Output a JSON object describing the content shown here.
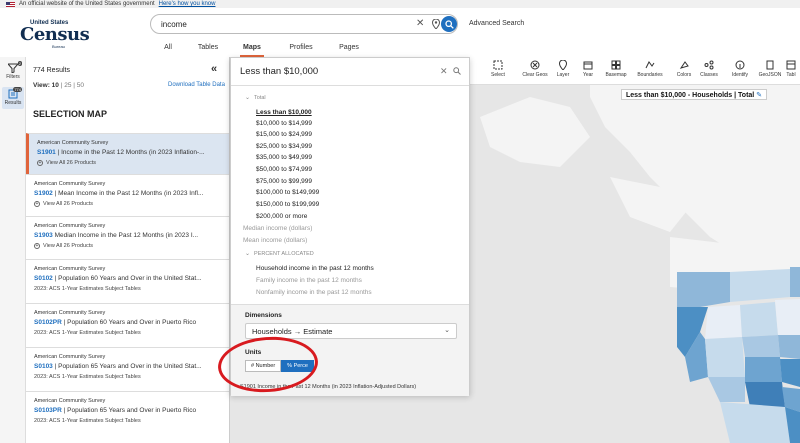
{
  "gov_banner": {
    "text": "An official website of the United States government",
    "link": "Here's how you know"
  },
  "logo": {
    "top": "United States",
    "main": "Census",
    "bureau": "Bureau"
  },
  "search": {
    "value": "income",
    "advanced": "Advanced Search"
  },
  "tabs": [
    {
      "label": "All",
      "active": false
    },
    {
      "label": "Tables",
      "active": false
    },
    {
      "label": "Maps",
      "active": true
    },
    {
      "label": "Profiles",
      "active": false
    },
    {
      "label": "Pages",
      "active": false
    }
  ],
  "rail": {
    "filters": {
      "label": "Filters",
      "badge": "2"
    },
    "results": {
      "label": "Results",
      "badge": "774"
    }
  },
  "results": {
    "count": "774 Results",
    "view_label": "View:",
    "view_options": [
      "10",
      "25",
      "50"
    ],
    "download": "Download Table Data",
    "heading": "SELECTION MAP",
    "cards": [
      {
        "source": "American Community Survey",
        "code": "S1901",
        "title": "Income in the Past 12 Months (in 2023 Inflation-...",
        "sub": "View All 26 Products",
        "plus": true,
        "active": true
      },
      {
        "source": "American Community Survey",
        "code": "S1902",
        "title": "Mean Income in the Past 12 Months (in 2023 Infl...",
        "sub": "View All 26 Products",
        "plus": true,
        "active": false
      },
      {
        "source": "American Community Survey",
        "code": "S1903",
        "title": "Median Income in the Past 12 Months (in 2023 I...",
        "sub": "View All 26 Products",
        "plus": true,
        "active": false
      },
      {
        "source": "American Community Survey",
        "code": "S0102",
        "title": "Population 60 Years and Over in the United Stat...",
        "sub": "2023: ACS 1-Year Estimates Subject Tables",
        "plus": false,
        "active": false
      },
      {
        "source": "American Community Survey",
        "code": "S0102PR",
        "title": "Population 60 Years and Over in Puerto Rico",
        "sub": "2023: ACS 1-Year Estimates Subject Tables",
        "plus": false,
        "active": false
      },
      {
        "source": "American Community Survey",
        "code": "S0103",
        "title": "Population 65 Years and Over in the United Stat...",
        "sub": "2023: ACS 1-Year Estimates Subject Tables",
        "plus": false,
        "active": false
      },
      {
        "source": "American Community Survey",
        "code": "S0103PR",
        "title": "Population 65 Years and Over in Puerto Rico",
        "sub": "2023: ACS 1-Year Estimates Subject Tables",
        "plus": false,
        "active": false
      }
    ]
  },
  "toolbar": [
    {
      "label": "Select",
      "icon": "select-icon"
    },
    {
      "label": "Clear Geos",
      "icon": "clear-icon"
    },
    {
      "label": "Layer",
      "icon": "layer-pin-icon"
    },
    {
      "label": "Year",
      "icon": "calendar-icon"
    },
    {
      "label": "Basemap",
      "icon": "basemap-icon"
    },
    {
      "label": "Boundaries",
      "icon": "boundaries-icon"
    },
    {
      "label": "Colors",
      "icon": "colors-icon"
    },
    {
      "label": "Classes",
      "icon": "classes-icon"
    },
    {
      "label": "Identify",
      "icon": "identify-icon"
    },
    {
      "label": "GeoJSON",
      "icon": "geojson-icon"
    },
    {
      "label": "Tabl",
      "icon": "table-icon"
    }
  ],
  "map": {
    "title": "Less than $10,000 - Households | Total"
  },
  "dropdown": {
    "value": "Less than $10,000",
    "rows": [
      {
        "text": "Total",
        "kind": "header"
      },
      {
        "text": "Less than $10,000",
        "kind": "selected"
      },
      {
        "text": "$10,000 to $14,999",
        "kind": "item"
      },
      {
        "text": "$15,000 to $24,999",
        "kind": "item"
      },
      {
        "text": "$25,000 to $34,999",
        "kind": "item"
      },
      {
        "text": "$35,000 to $49,999",
        "kind": "item"
      },
      {
        "text": "$50,000 to $74,999",
        "kind": "item"
      },
      {
        "text": "$75,000 to $99,999",
        "kind": "item"
      },
      {
        "text": "$100,000 to $149,999",
        "kind": "item"
      },
      {
        "text": "$150,000 to $199,999",
        "kind": "item"
      },
      {
        "text": "$200,000 or more",
        "kind": "item"
      },
      {
        "text": "Median income (dollars)",
        "kind": "muted"
      },
      {
        "text": "Mean income (dollars)",
        "kind": "muted"
      },
      {
        "text": "PERCENT ALLOCATED",
        "kind": "header"
      },
      {
        "text": "Household income in the past 12 months",
        "kind": "item"
      },
      {
        "text": "Family income in the past 12 months",
        "kind": "muted"
      },
      {
        "text": "Nonfamily income in the past 12 months",
        "kind": "muted"
      }
    ],
    "dimensions_label": "Dimensions",
    "dimensions_value": "Households → Estimate",
    "units_label": "Units",
    "unit_number": "# Number",
    "unit_percent": "% Perce",
    "footer": "S1901 Income in the Past 12 Months (in 2023 Inflation-Adjusted Dollars)"
  },
  "colors": {
    "accent": "#e0643b",
    "primary": "#1f6fbf",
    "annotation": "#d81a1f"
  }
}
